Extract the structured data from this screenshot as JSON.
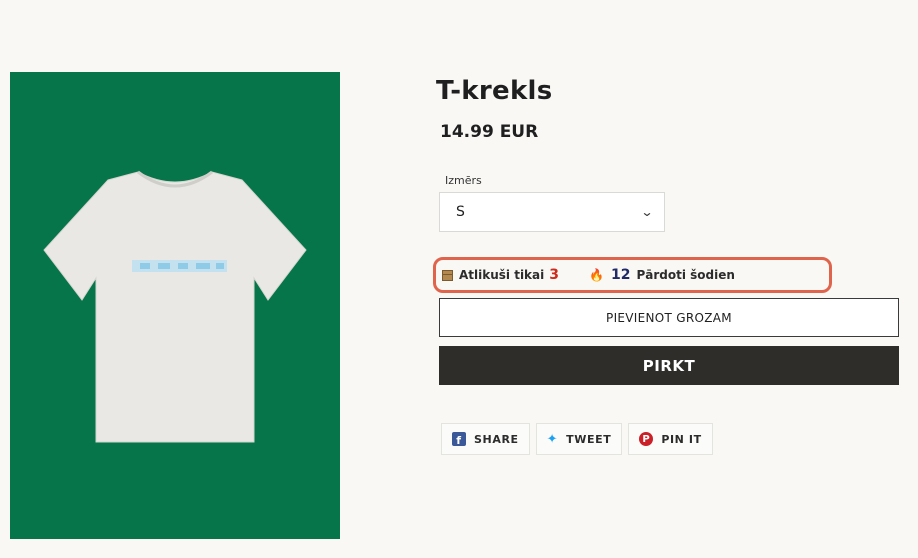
{
  "product": {
    "title": "T-krekls",
    "price": "14.99 EUR",
    "image_alt_icon": "tshirt-image",
    "colors": {
      "background": "#06754a",
      "shirt": "#e9e8e4"
    }
  },
  "size": {
    "label": "Izmērs",
    "selected": "S",
    "chevron_icon": "chevron-down-icon"
  },
  "stock": {
    "left_label": "Atlikuši tikai",
    "left_count": "3",
    "sold_count": "12",
    "sold_label": "Pārdoti šodien",
    "box_icon": "box-icon",
    "fire_icon": "fire-icon",
    "highlight_color": "#e0644c"
  },
  "actions": {
    "add_to_cart": "PIEVIENOT GROZAM",
    "buy": "PIRKT"
  },
  "share": {
    "facebook": "SHARE",
    "twitter": "TWEET",
    "pinterest": "PIN IT"
  }
}
